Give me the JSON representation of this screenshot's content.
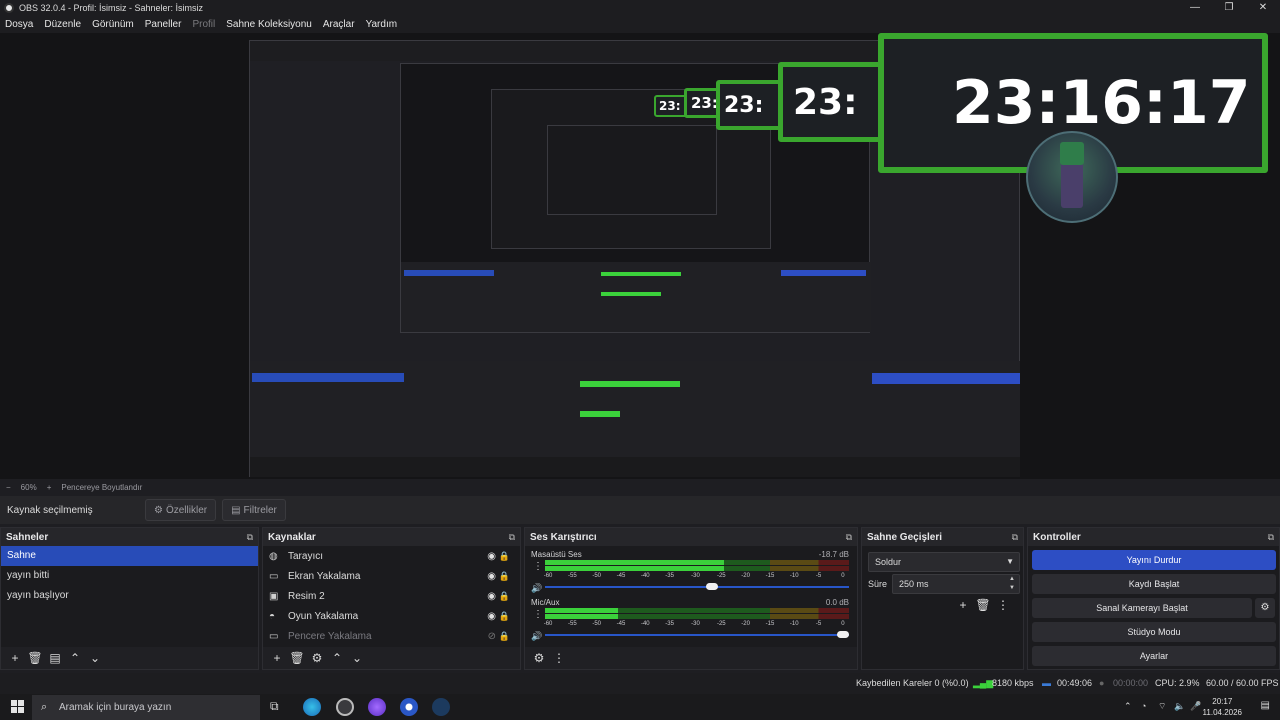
{
  "window": {
    "title": "OBS 32.0.4 - Profil: İsimsiz - Sahneler: İsimsiz",
    "controls": [
      "—",
      "❐",
      "✕"
    ]
  },
  "menu": {
    "items": [
      "Dosya",
      "Düzenle",
      "Görünüm",
      "Paneller",
      "Profil",
      "Sahne Koleksiyonu",
      "Araçlar",
      "Yardım"
    ]
  },
  "preview": {
    "clock_text": "23:16:17",
    "clock_partial": "23:",
    "accent_green": "#3aa62e"
  },
  "zoom": {
    "level": "60%",
    "mode": "Pencereye Boyutlandır"
  },
  "source_bar": {
    "label": "Kaynak seçilmemiş",
    "properties_label": "Özellikler",
    "filters_label": "Filtreler"
  },
  "scenes": {
    "title": "Sahneler",
    "items": [
      "Sahne",
      "yayın bitti",
      "yayın başlıyor"
    ],
    "selected": 0
  },
  "sources": {
    "title": "Kaynaklar",
    "items": [
      {
        "label": "Tarayıcı",
        "icon": "globe-icon",
        "visible": true
      },
      {
        "label": "Ekran Yakalama",
        "icon": "monitor-icon",
        "visible": true
      },
      {
        "label": "Resim 2",
        "icon": "image-icon",
        "visible": true
      },
      {
        "label": "Oyun Yakalama",
        "icon": "gamepad-icon",
        "visible": true
      },
      {
        "label": "Pencere Yakalama",
        "icon": "window-icon",
        "visible": false
      }
    ]
  },
  "mixer": {
    "title": "Ses Karıştırıcı",
    "channels": [
      {
        "name": "Masaüstü Ses",
        "db": "-18.7 dB",
        "level": 0.78,
        "volume": 0.6
      },
      {
        "name": "Mic/Aux",
        "db": "0.0 dB",
        "level": 0.25,
        "volume": 0.98
      }
    ],
    "ticks": [
      "-60",
      "-55",
      "-50",
      "-45",
      "-40",
      "-35",
      "-30",
      "-25",
      "-20",
      "-15",
      "-10",
      "-5",
      "0"
    ]
  },
  "transitions": {
    "title": "Sahne Geçişleri",
    "selected": "Soldur",
    "duration_label": "Süre",
    "duration_value": "250 ms"
  },
  "controls": {
    "title": "Kontroller",
    "stop_stream": "Yayını Durdur",
    "start_record": "Kaydı Başlat",
    "virtual_cam": "Sanal Kamerayı Başlat",
    "studio_mode": "Stüdyo Modu",
    "settings": "Ayarlar"
  },
  "status": {
    "dropped": "Kaybedilen Kareler 0 (%0.0)",
    "bitrate": "8180 kbps",
    "stream_time": "00:49:06",
    "record_time": "00:00:00",
    "cpu": "CPU: 2.9%",
    "fps": "60.00 / 60.00 FPS"
  },
  "taskbar": {
    "search_placeholder": "Aramak için buraya yazın",
    "time": "20:17",
    "date": "11.04.2026"
  }
}
